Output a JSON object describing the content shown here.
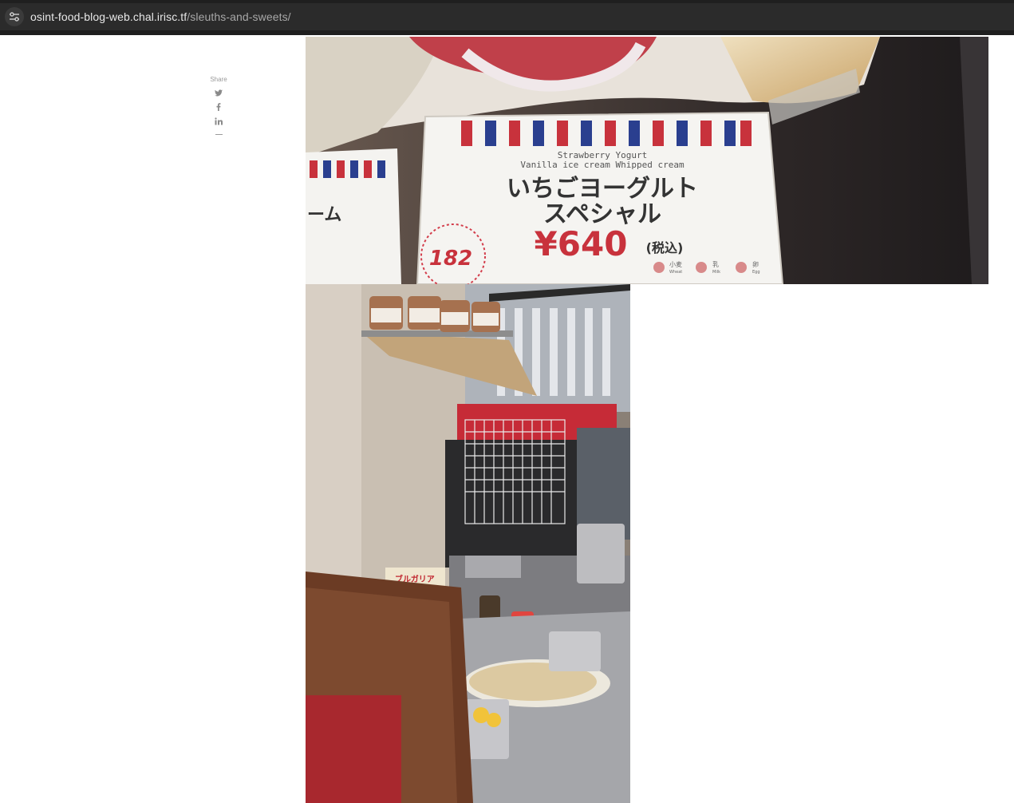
{
  "browser": {
    "url_host": "osint-food-blog-web.chal.irisc.tf",
    "url_path": "/sleuths-and-sweets/",
    "site_info_icon": "tune-icon"
  },
  "share": {
    "label": "Share",
    "icons": [
      "twitter-icon",
      "facebook-icon",
      "linkedin-icon"
    ]
  },
  "photo1": {
    "tag_en_line1": "Strawberry Yogurt",
    "tag_en_line2": "Vanilla ice cream Whipped cream",
    "tag_jp_line1": "いちごヨーグルト",
    "tag_jp_line2": "スペシャル",
    "tag_number": "182",
    "tag_price": "¥640",
    "tag_tax": "(税込)",
    "allergen1": "小麦",
    "allergen1_en": "Wheat",
    "allergen2": "乳",
    "allergen2_en": "Milk",
    "allergen3": "卵",
    "allergen3_en": "Egg",
    "left_tag_text": "ーム"
  },
  "photo2": {
    "container_label": "ブルガリア"
  },
  "colors": {
    "chrome_bg": "#2b2b2b",
    "tag_red": "#c8323c",
    "tag_blue": "#2a3f8f"
  }
}
